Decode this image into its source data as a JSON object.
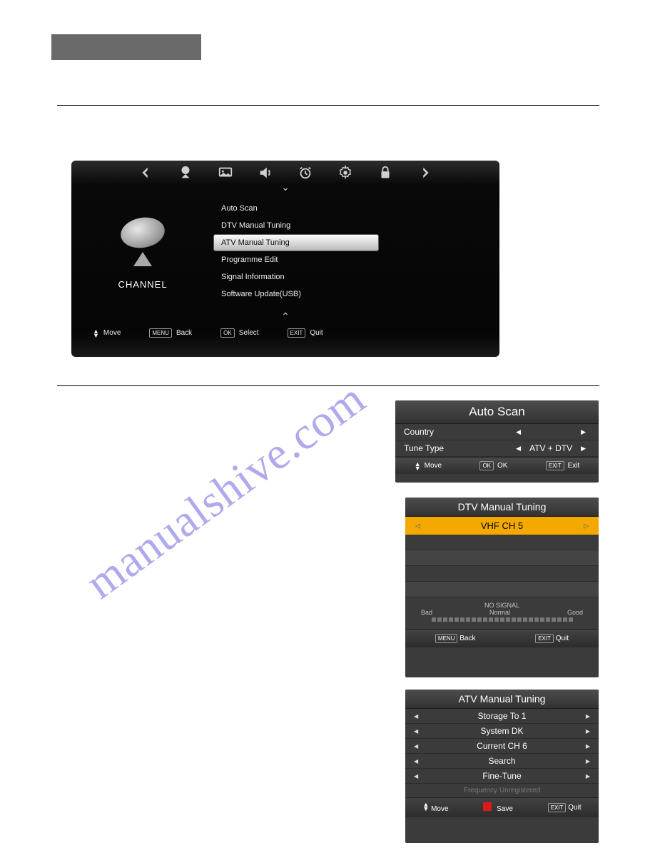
{
  "watermark": "manualshive.com",
  "tv_menu": {
    "section_label": "CHANNEL",
    "items": [
      "Auto Scan",
      "DTV Manual Tuning",
      "ATV Manual Tuning",
      "Programme Edit",
      "Signal Information",
      "Software Update(USB)"
    ],
    "selected_index": 2,
    "footer": {
      "move": "Move",
      "back_key": "MENU",
      "back": "Back",
      "select_key": "OK",
      "select": "Select",
      "quit_key": "EXIT",
      "quit": "Quit"
    }
  },
  "autoscan": {
    "title": "Auto Scan",
    "rows": [
      {
        "label": "Country",
        "value": ""
      },
      {
        "label": "Tune Type",
        "value": "ATV + DTV"
      }
    ],
    "footer": {
      "move": "Move",
      "ok_key": "OK",
      "ok": "OK",
      "exit_key": "EXIT",
      "exit": "Exit"
    }
  },
  "dtv": {
    "title": "DTV Manual Tuning",
    "channel": "VHF  CH 5",
    "no_signal": "NO SIGNAL",
    "legend": {
      "bad": "Bad",
      "normal": "Normal",
      "good": "Good"
    },
    "footer": {
      "back_key": "MENU",
      "back": "Back",
      "quit_key": "EXIT",
      "quit": "Quit"
    }
  },
  "atv": {
    "title": "ATV Manual Tuning",
    "rows": [
      "Storage To  1",
      "System  DK",
      "Current CH  6",
      "Search",
      "Fine-Tune"
    ],
    "freq_status": "Frequency Unregistered",
    "footer": {
      "move": "Move",
      "save": "Save",
      "quit_key": "EXIT",
      "quit": "Quit"
    }
  }
}
